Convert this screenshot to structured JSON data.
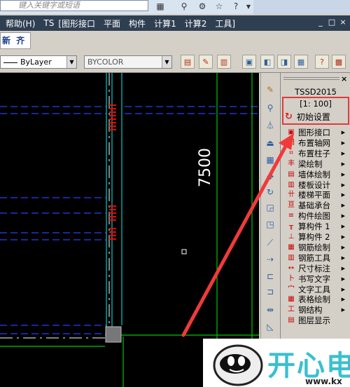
{
  "search": {
    "placeholder": "键入关键字或短语"
  },
  "menu": [
    {
      "label": "帮助(H)"
    },
    {
      "label": "TS"
    },
    {
      "label": "[图形接口"
    },
    {
      "label": "平面"
    },
    {
      "label": "构件"
    },
    {
      "label": "计算1"
    },
    {
      "label": "计算2"
    },
    {
      "label": "工具]"
    }
  ],
  "window_controls": [
    "_",
    "□",
    "×"
  ],
  "toolbar": {
    "align_label": "新 齐",
    "layer_value": "ByLayer",
    "color_value": "BYCOLOR"
  },
  "drawing": {
    "dimension_text": "7500"
  },
  "panel": {
    "title": "TSSD2015",
    "scale": "[1: 100]",
    "init_button": "初始设置",
    "items": [
      {
        "label": "图形接口",
        "icon": "interface-icon",
        "sub": true
      },
      {
        "label": "布置轴网",
        "icon": "grid-icon",
        "sub": true
      },
      {
        "label": "布置柱子",
        "icon": "column-icon",
        "sub": true
      },
      {
        "label": "梁绘制",
        "icon": "beam-icon",
        "sub": true
      },
      {
        "label": "墙体绘制",
        "icon": "wall-icon",
        "sub": true
      },
      {
        "label": "楼板设计",
        "icon": "slab-icon",
        "sub": true
      },
      {
        "label": "楼梯平面",
        "icon": "stair-icon",
        "sub": true
      },
      {
        "label": "基础承台",
        "icon": "foundation-icon",
        "sub": true
      },
      {
        "label": "构件绘图",
        "icon": "member-draw-icon",
        "sub": true
      },
      {
        "label": "算构件 1",
        "icon": "calc1-icon",
        "sub": true
      },
      {
        "label": "算构件 2",
        "icon": "calc2-icon",
        "sub": true
      },
      {
        "label": "钢筋绘制",
        "icon": "rebar-draw-icon",
        "sub": true
      },
      {
        "label": "钢筋工具",
        "icon": "rebar-tool-icon",
        "sub": true
      },
      {
        "label": "尺寸标注",
        "icon": "dimension-icon",
        "sub": true
      },
      {
        "label": "书写文字",
        "icon": "text-write-icon",
        "sub": true
      },
      {
        "label": "文字工具",
        "icon": "text-tool-icon",
        "sub": true
      },
      {
        "label": "表格绘制",
        "icon": "table-icon",
        "sub": true
      },
      {
        "label": "钢结构",
        "icon": "steel-icon",
        "sub": true
      },
      {
        "label": "图层显示",
        "icon": "layer-icon",
        "sub": false
      }
    ]
  },
  "watermark": {
    "text": "开心电",
    "sub": "www.kx"
  },
  "colors": {
    "menubar": "#2f3f52",
    "canvas": "#000000",
    "green_line": "#00c800",
    "cyan_line": "#00cccc",
    "blue_dash": "#2a3cff",
    "red_mark": "#ff0000",
    "highlight": "#e23a3a"
  }
}
